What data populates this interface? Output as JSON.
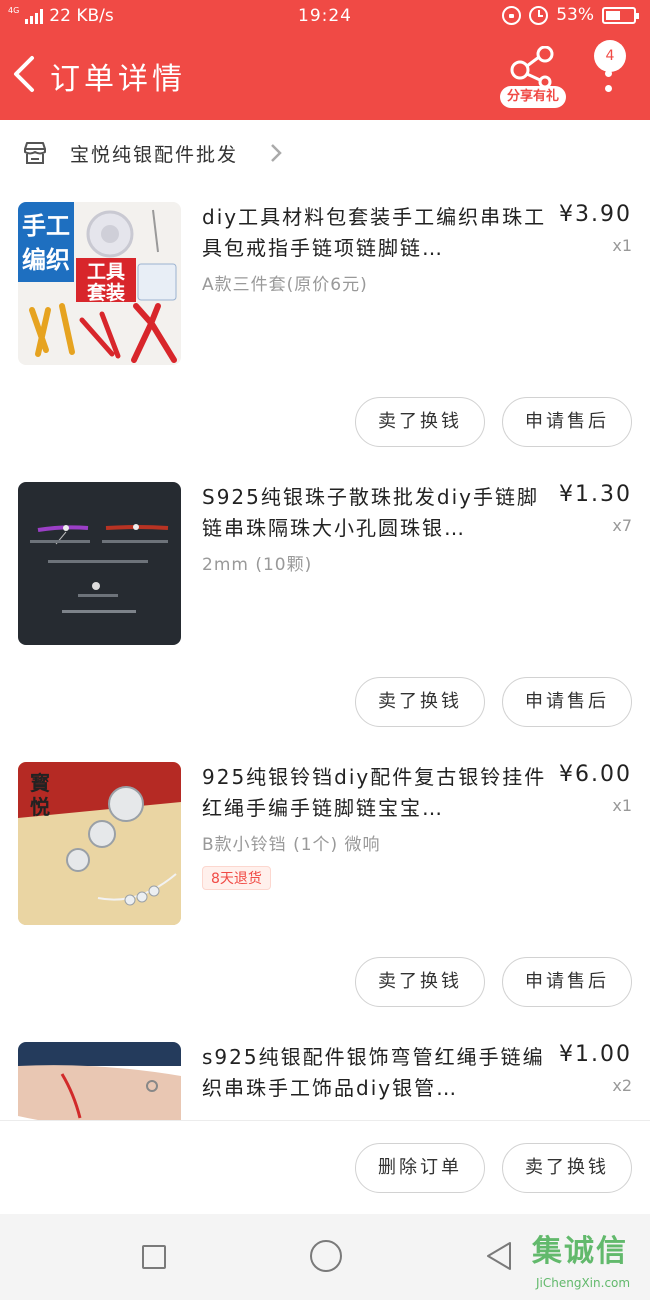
{
  "status_bar": {
    "network": "4G",
    "speed": "22 KB/s",
    "time": "19:24",
    "battery": "53%",
    "battery_level": 0.53
  },
  "header": {
    "title": "订单详情",
    "share_label": "分享有礼",
    "message_badge": "4"
  },
  "shop": {
    "name": "宝悦纯银配件批发"
  },
  "items": [
    {
      "title": "diy工具材料包套装手工编织串珠工具包戒指手链项链脚链…",
      "spec": "A款三件套(原价6元)",
      "price": "¥3.90",
      "qty": "x1",
      "tag": "",
      "image": "tool-kit-product-photo",
      "image_labels": [
        "手工",
        "编织",
        "工具",
        "套装"
      ],
      "btn_refund": "卖了换钱",
      "btn_aftersale": "申请售后"
    },
    {
      "title": "S925纯银珠子散珠批发diy手链脚链串珠隔珠大小孔圆珠银…",
      "spec": "2mm (10颗)",
      "price": "¥1.30",
      "qty": "x7",
      "tag": "",
      "image": "silver-beads-product-photo",
      "btn_refund": "卖了换钱",
      "btn_aftersale": "申请售后"
    },
    {
      "title": "925纯银铃铛diy配件复古银铃挂件红绳手编手链脚链宝宝…",
      "spec": "B款小铃铛 (1个) 微响",
      "price": "¥6.00",
      "qty": "x1",
      "tag": "8天退货",
      "image": "silver-bells-product-photo",
      "image_labels": [
        "寳",
        "悦"
      ],
      "btn_refund": "卖了换钱",
      "btn_aftersale": "申请售后"
    },
    {
      "title": "s925纯银配件银饰弯管红绳手链编织串珠手工饰品diy银管…",
      "spec": "",
      "price": "¥1.00",
      "qty": "x2",
      "tag": "",
      "image": "red-string-bracelet-photo"
    }
  ],
  "bottom_bar": {
    "delete_label": "删除订单",
    "resell_label": "卖了换钱"
  },
  "watermark": {
    "main": "集诚信",
    "sub": "JiChengXin.com"
  },
  "icons": {
    "back": "chevron-left-icon",
    "share": "share-icon",
    "more": "more-vertical-icon",
    "store": "store-icon",
    "chevron": "chevron-right-icon"
  },
  "colors": {
    "brand": "#f04a45",
    "tag_bg": "#fff0ec",
    "muted_text": "#999999"
  }
}
